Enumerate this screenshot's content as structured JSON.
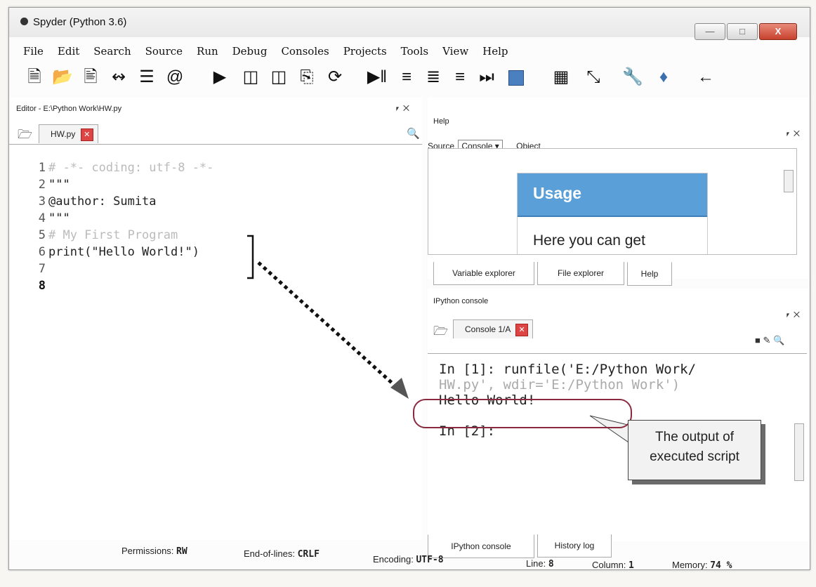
{
  "window": {
    "title": "Spyder (Python 3.6)"
  },
  "menu": [
    "File",
    "Edit",
    "Search",
    "Source",
    "Run",
    "Debug",
    "Consoles",
    "Projects",
    "Tools",
    "View",
    "Help"
  ],
  "toolbar_icons": [
    "new-file",
    "open-folder",
    "save",
    "save-all",
    "list",
    "at",
    "run",
    "run-cell",
    "run-cell-advance",
    "run-selection",
    "rerun",
    "debug",
    "step",
    "step-into",
    "step-return",
    "continue",
    "stop",
    "maximize-pane",
    "fullscreen",
    "preferences",
    "python-path",
    "back-arrow"
  ],
  "editor": {
    "title": "Editor - E:\\Python Work\\HW.py",
    "tab_label": "HW.py",
    "lines": [
      {
        "num": "1",
        "text": "# -*- coding: utf-8 -*-",
        "faded": true
      },
      {
        "num": "2",
        "text": "\"\"\"",
        "faded": false
      },
      {
        "num": "3",
        "text": "@author: Sumita",
        "faded": false
      },
      {
        "num": "4",
        "text": "\"\"\"",
        "faded": false
      },
      {
        "num": "5",
        "text": "# My First Program",
        "faded": true
      },
      {
        "num": "6",
        "text": "print(\"Hello World!\")",
        "faded": false
      },
      {
        "num": "7",
        "text": "",
        "faded": false
      },
      {
        "num": "8",
        "text": "",
        "faded": false
      }
    ]
  },
  "help": {
    "title": "Help",
    "source_label": "Source",
    "source_value": "Console",
    "object_label": "Object",
    "usage_title": "Usage",
    "usage_text": "Here you can get",
    "tabs": [
      "Variable explorer",
      "File explorer",
      "Help"
    ]
  },
  "console": {
    "title": "IPython console",
    "tab_label": "Console 1/A",
    "line1": "In [1]: runfile('E:/Python Work/",
    "line2": "HW.py', wdir='E:/Python Work')",
    "output": "Hello World!",
    "prompt2": "In [2]:",
    "tabs": [
      "IPython console",
      "History log"
    ]
  },
  "callout": {
    "line1": "The output of",
    "line2": "executed script"
  },
  "status": {
    "permissions_label": "Permissions:",
    "permissions_value": "RW",
    "eol_label": "End-of-lines:",
    "eol_value": "CRLF",
    "encoding_label": "Encoding:",
    "encoding_value": "UTF-8",
    "line_label": "Line:",
    "line_value": "8",
    "column_label": "Column:",
    "column_value": "1",
    "memory_label": "Memory:",
    "memory_value": "74 %"
  }
}
